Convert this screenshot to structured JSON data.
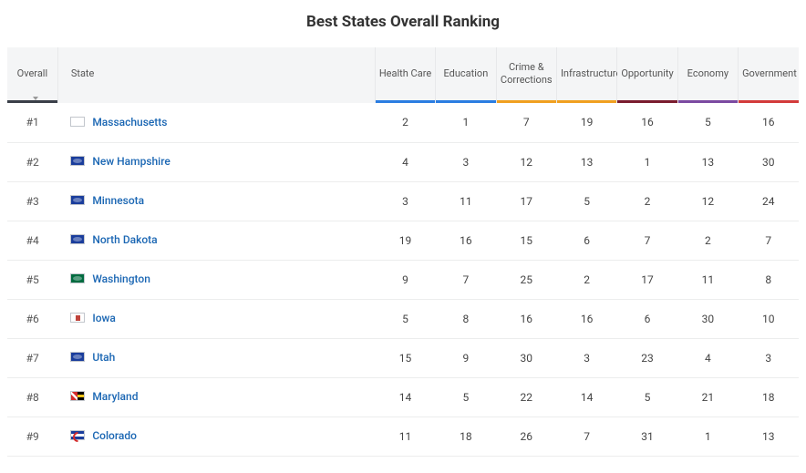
{
  "title": "Best States Overall Ranking",
  "columns": {
    "overall": "Overall",
    "state": "State",
    "health": "Health Care",
    "education": "Education",
    "crime": "Crime & Corrections",
    "infrastructure": "Infrastructure",
    "opportunity": "Opportunity",
    "economy": "Economy",
    "government": "Government"
  },
  "rows": [
    {
      "rank": "#1",
      "state": "Massachusetts",
      "flag": "ma",
      "health": 2,
      "education": 1,
      "crime": 7,
      "infrastructure": 19,
      "opportunity": 16,
      "economy": 5,
      "government": 16
    },
    {
      "rank": "#2",
      "state": "New Hampshire",
      "flag": "nh",
      "health": 4,
      "education": 3,
      "crime": 12,
      "infrastructure": 13,
      "opportunity": 1,
      "economy": 13,
      "government": 30
    },
    {
      "rank": "#3",
      "state": "Minnesota",
      "flag": "mn",
      "health": 3,
      "education": 11,
      "crime": 17,
      "infrastructure": 5,
      "opportunity": 2,
      "economy": 12,
      "government": 24
    },
    {
      "rank": "#4",
      "state": "North Dakota",
      "flag": "nd",
      "health": 19,
      "education": 16,
      "crime": 15,
      "infrastructure": 6,
      "opportunity": 7,
      "economy": 2,
      "government": 7
    },
    {
      "rank": "#5",
      "state": "Washington",
      "flag": "wa",
      "health": 9,
      "education": 7,
      "crime": 25,
      "infrastructure": 2,
      "opportunity": 17,
      "economy": 11,
      "government": 8
    },
    {
      "rank": "#6",
      "state": "Iowa",
      "flag": "ia",
      "health": 5,
      "education": 8,
      "crime": 16,
      "infrastructure": 16,
      "opportunity": 6,
      "economy": 30,
      "government": 10
    },
    {
      "rank": "#7",
      "state": "Utah",
      "flag": "ut",
      "health": 15,
      "education": 9,
      "crime": 30,
      "infrastructure": 3,
      "opportunity": 23,
      "economy": 4,
      "government": 3
    },
    {
      "rank": "#8",
      "state": "Maryland",
      "flag": "md",
      "health": 14,
      "education": 5,
      "crime": 22,
      "infrastructure": 14,
      "opportunity": 5,
      "economy": 21,
      "government": 18
    },
    {
      "rank": "#9",
      "state": "Colorado",
      "flag": "co",
      "health": 11,
      "education": 18,
      "crime": 26,
      "infrastructure": 7,
      "opportunity": 31,
      "economy": 1,
      "government": 13
    }
  ]
}
